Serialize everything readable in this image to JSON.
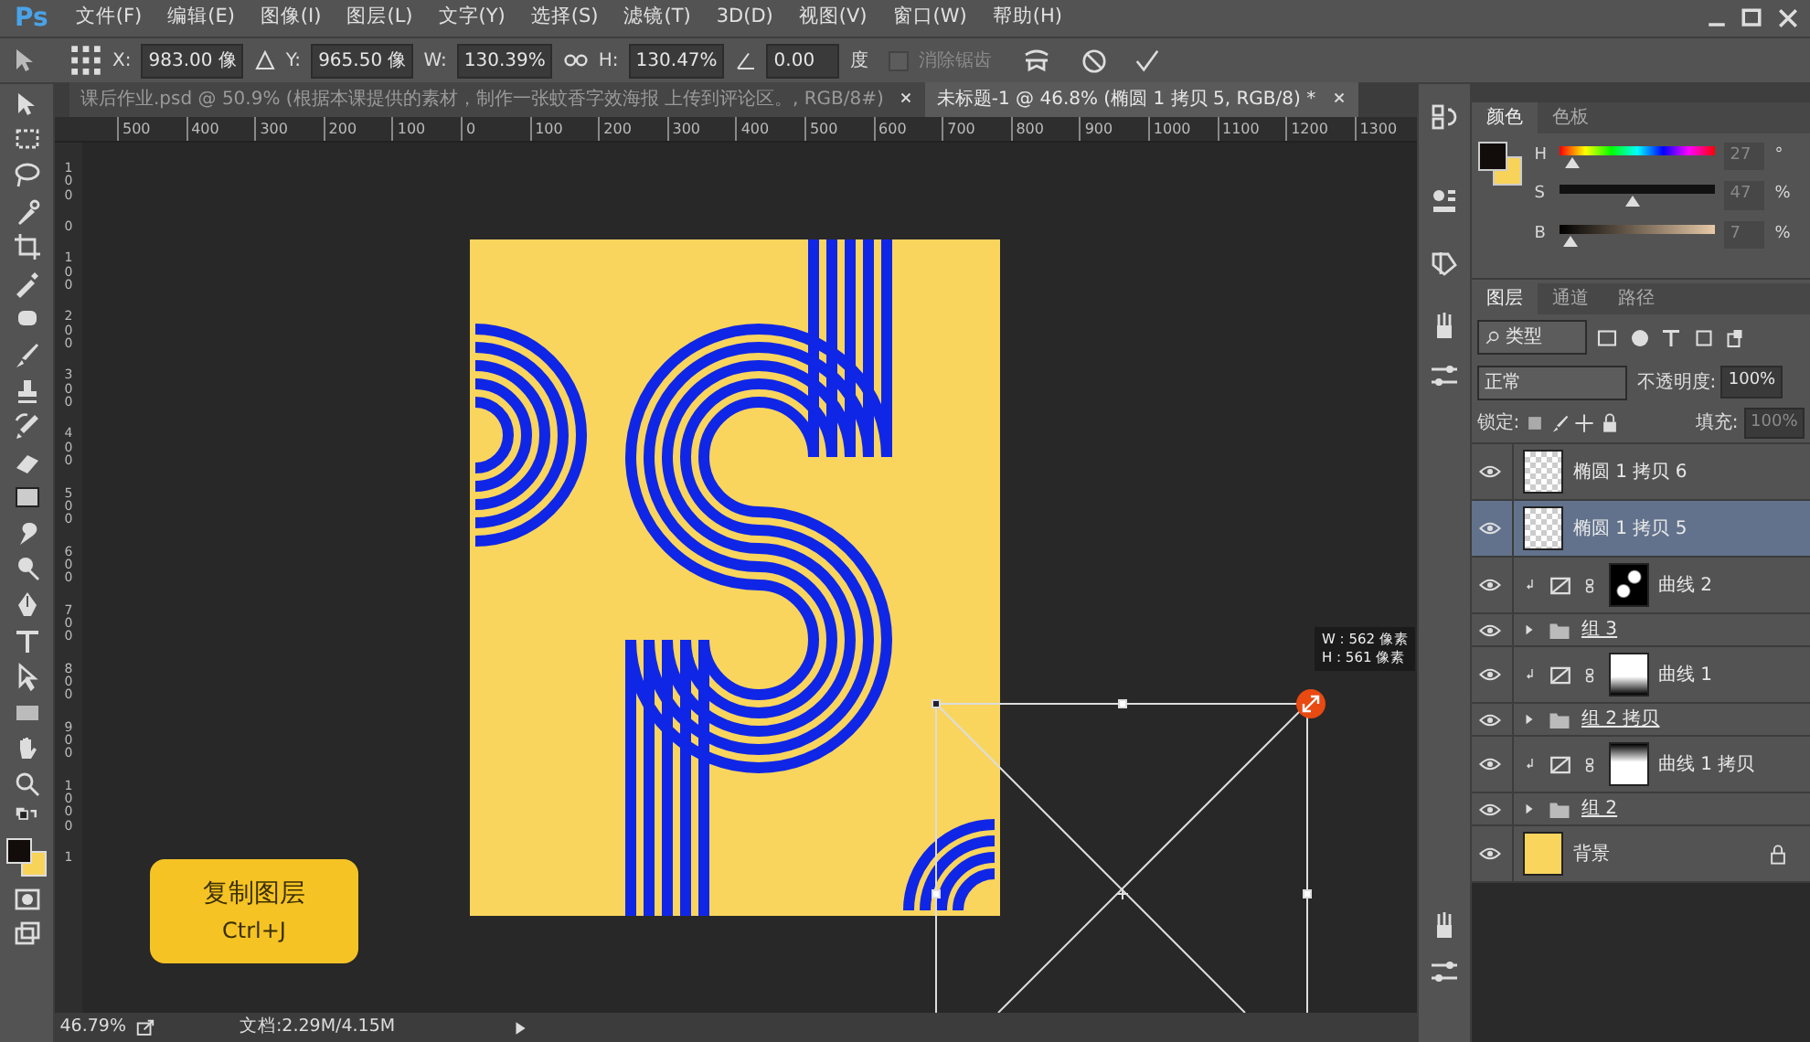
{
  "menu_bar": {
    "logo": "Ps",
    "items": [
      "文件(F)",
      "编辑(E)",
      "图像(I)",
      "图层(L)",
      "文字(Y)",
      "选择(S)",
      "滤镜(T)",
      "3D(D)",
      "视图(V)",
      "窗口(W)",
      "帮助(H)"
    ]
  },
  "options_bar": {
    "x_label": "X:",
    "x_value": "983.00 像",
    "y_label": "Y:",
    "y_value": "965.50 像",
    "w_label": "W:",
    "w_value": "130.39%",
    "h_label": "H:",
    "h_value": "130.47%",
    "angle_value": "0.00",
    "angle_unit": "度",
    "anti_alias": {
      "label": "消除锯齿",
      "checked": false,
      "disabled": true
    }
  },
  "document_tabs": [
    {
      "title": "课后作业.psd @ 50.9% (根据本课提供的素材，制作一张蚊香字效海报 上传到评论区。, RGB/8#)",
      "selected": false
    },
    {
      "title": "未标题-1 @ 46.8% (椭圆 1 拷贝 5, RGB/8) *",
      "selected": true
    }
  ],
  "horizontal_ruler": [
    "500",
    "400",
    "300",
    "200",
    "100",
    "0",
    "100",
    "200",
    "300",
    "400",
    "500",
    "600",
    "700",
    "800",
    "900",
    "1000",
    "1100",
    "1200",
    "1300"
  ],
  "vertical_ruler": [
    "100",
    "0",
    "100",
    "200",
    "300",
    "400",
    "500",
    "600",
    "700",
    "800",
    "900",
    "1000",
    "1"
  ],
  "canvas": {
    "caption": {
      "title": "复制图层",
      "shortcut": "Ctrl+J"
    },
    "size_tooltip": [
      "W : 562 像素",
      "H : 561 像素"
    ]
  },
  "status_bar": {
    "zoom": "46.79%",
    "document_size": "文档:2.29M/4.15M"
  },
  "color_panel": {
    "tabs": [
      {
        "label": "颜色",
        "selected": true
      },
      {
        "label": "色板",
        "selected": false
      }
    ],
    "channels": [
      {
        "label": "H",
        "value": "27",
        "unit": "°",
        "level": 0.08
      },
      {
        "label": "S",
        "value": "47",
        "unit": "%",
        "level": 0.47
      },
      {
        "label": "B",
        "value": "7",
        "unit": "%",
        "level": 0.07
      }
    ]
  },
  "layers_panel": {
    "tabs": [
      {
        "label": "图层",
        "selected": true
      },
      {
        "label": "通道",
        "selected": false
      },
      {
        "label": "路径",
        "selected": false
      }
    ],
    "filter": "类型",
    "blend_mode": "正常",
    "opacity_label": "不透明度:",
    "opacity": "100%",
    "lock_label": "锁定:",
    "fill_label": "填充:",
    "fill": "100%",
    "layers": [
      {
        "name": "椭圆 1 拷贝 6",
        "kind": "smart",
        "visible": true,
        "selected": false
      },
      {
        "name": "椭圆 1 拷贝 5",
        "kind": "smart",
        "visible": true,
        "selected": true
      },
      {
        "name": "曲线 2",
        "kind": "adjustment",
        "mask": {
          "kind": "spots"
        },
        "clipped": true,
        "visible": true,
        "selected": false
      },
      {
        "name": "组 3",
        "kind": "group",
        "expanded": false,
        "visible": true,
        "selected": false
      },
      {
        "name": "曲线 1",
        "kind": "adjustment",
        "mask": {
          "kind": "fade-down"
        },
        "clipped": true,
        "visible": true,
        "selected": false
      },
      {
        "name": "组 2 拷贝",
        "kind": "group",
        "expanded": false,
        "visible": true,
        "selected": false
      },
      {
        "name": "曲线 1 拷贝",
        "kind": "adjustment",
        "mask": {
          "kind": "fade-up"
        },
        "clipped": true,
        "visible": true,
        "selected": false
      },
      {
        "name": "组 2",
        "kind": "group",
        "expanded": false,
        "visible": true,
        "selected": false
      },
      {
        "name": "背景",
        "kind": "background",
        "locked": true,
        "visible": true,
        "selected": false
      }
    ]
  }
}
